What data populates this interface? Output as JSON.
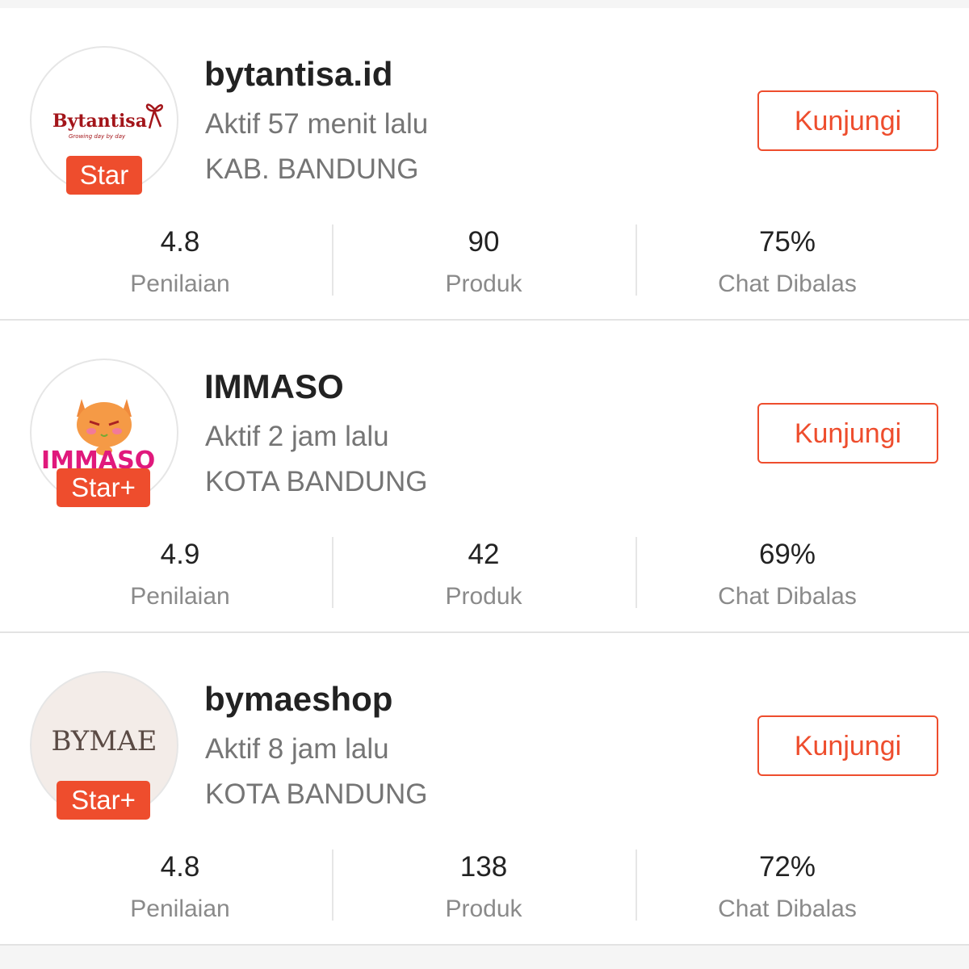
{
  "shops": [
    {
      "name": "bytantisa.id",
      "active": "Aktif 57 menit lalu",
      "location": "KAB. BANDUNG",
      "badge": "Star",
      "logo_text": "Bytantisa",
      "logo_tagline": "Growing day by day",
      "visit_label": "Kunjungi",
      "stats": [
        {
          "value": "4.8",
          "label": "Penilaian"
        },
        {
          "value": "90",
          "label": "Produk"
        },
        {
          "value": "75%",
          "label": "Chat Dibalas"
        }
      ]
    },
    {
      "name": "IMMASO",
      "active": "Aktif 2 jam lalu",
      "location": "KOTA BANDUNG",
      "badge": "Star+",
      "logo_text": "IMMASO",
      "visit_label": "Kunjungi",
      "stats": [
        {
          "value": "4.9",
          "label": "Penilaian"
        },
        {
          "value": "42",
          "label": "Produk"
        },
        {
          "value": "69%",
          "label": "Chat Dibalas"
        }
      ]
    },
    {
      "name": "bymaeshop",
      "active": "Aktif 8 jam lalu",
      "location": "KOTA BANDUNG",
      "badge": "Star+",
      "logo_text": "BYMAE",
      "visit_label": "Kunjungi",
      "stats": [
        {
          "value": "4.8",
          "label": "Penilaian"
        },
        {
          "value": "138",
          "label": "Produk"
        },
        {
          "value": "72%",
          "label": "Chat Dibalas"
        }
      ]
    }
  ],
  "colors": {
    "accent": "#ee4d2d",
    "text_primary": "#222222",
    "text_secondary": "#757575"
  },
  "icons": [
    "cat-icon",
    "ribbon-icon"
  ]
}
